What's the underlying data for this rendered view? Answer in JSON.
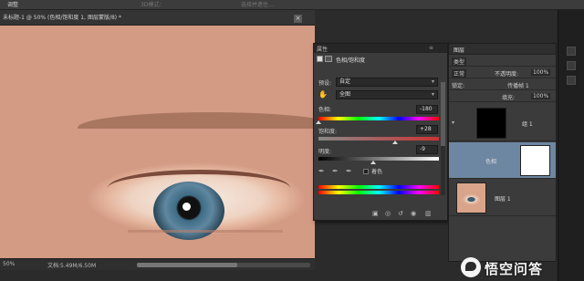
{
  "app": {
    "menu_left": "调整",
    "menu_dim": "3D模式：",
    "menu_right": "选择并遮住…"
  },
  "document": {
    "tab_title": "未标题-1 @ 50% (色相/饱和度 1, 图层蒙版/8) *",
    "close_label": "×",
    "zoom": "50%",
    "doc_info": "文档:5.49M/6.50M"
  },
  "properties": {
    "panel_title": "属性",
    "panel_controls": "≡",
    "type_label": "色相/饱和度",
    "preset_label": "预设:",
    "preset_value": "自定",
    "channel_value": "全图",
    "hue_label": "色相:",
    "hue_value": "-180",
    "hue_fraction": 0.0,
    "saturation_label": "饱和度:",
    "saturation_value": "+28",
    "saturation_fraction": 0.64,
    "lightness_label": "明度:",
    "lightness_value": "-9",
    "lightness_fraction": 0.455,
    "colorize_label": "着色",
    "caret": "▾",
    "icons": {
      "hand": "hand-icon",
      "eyedropper": "eyedropper-icon",
      "eyedropper_plus": "eyedropper-plus-icon",
      "eyedropper_minus": "eyedropper-minus-icon",
      "clip": "clip-to-layer-icon",
      "visibility": "visibility-icon",
      "reset": "reset-icon",
      "view_previous": "view-previous-icon",
      "delete": "trash-icon"
    }
  },
  "layers": {
    "tab_label": "图层",
    "kind_label": "类型",
    "blend_mode": "正常",
    "opacity_label": "不透明度:",
    "opacity_value": "100%",
    "lock_label": "锁定:",
    "fill_label": "填充:",
    "fill_value": "100%",
    "propagate_label": "传播帧 1",
    "group_name": "组 1",
    "adjust_layer_name": "色相",
    "image_layer_name": "图层 1"
  },
  "watermark": {
    "text": "悟空问答"
  },
  "colors": {
    "panel_bg": "#3b3b3b",
    "selected_layer": "#6d87a2",
    "app_bg": "#2b2b2b"
  }
}
